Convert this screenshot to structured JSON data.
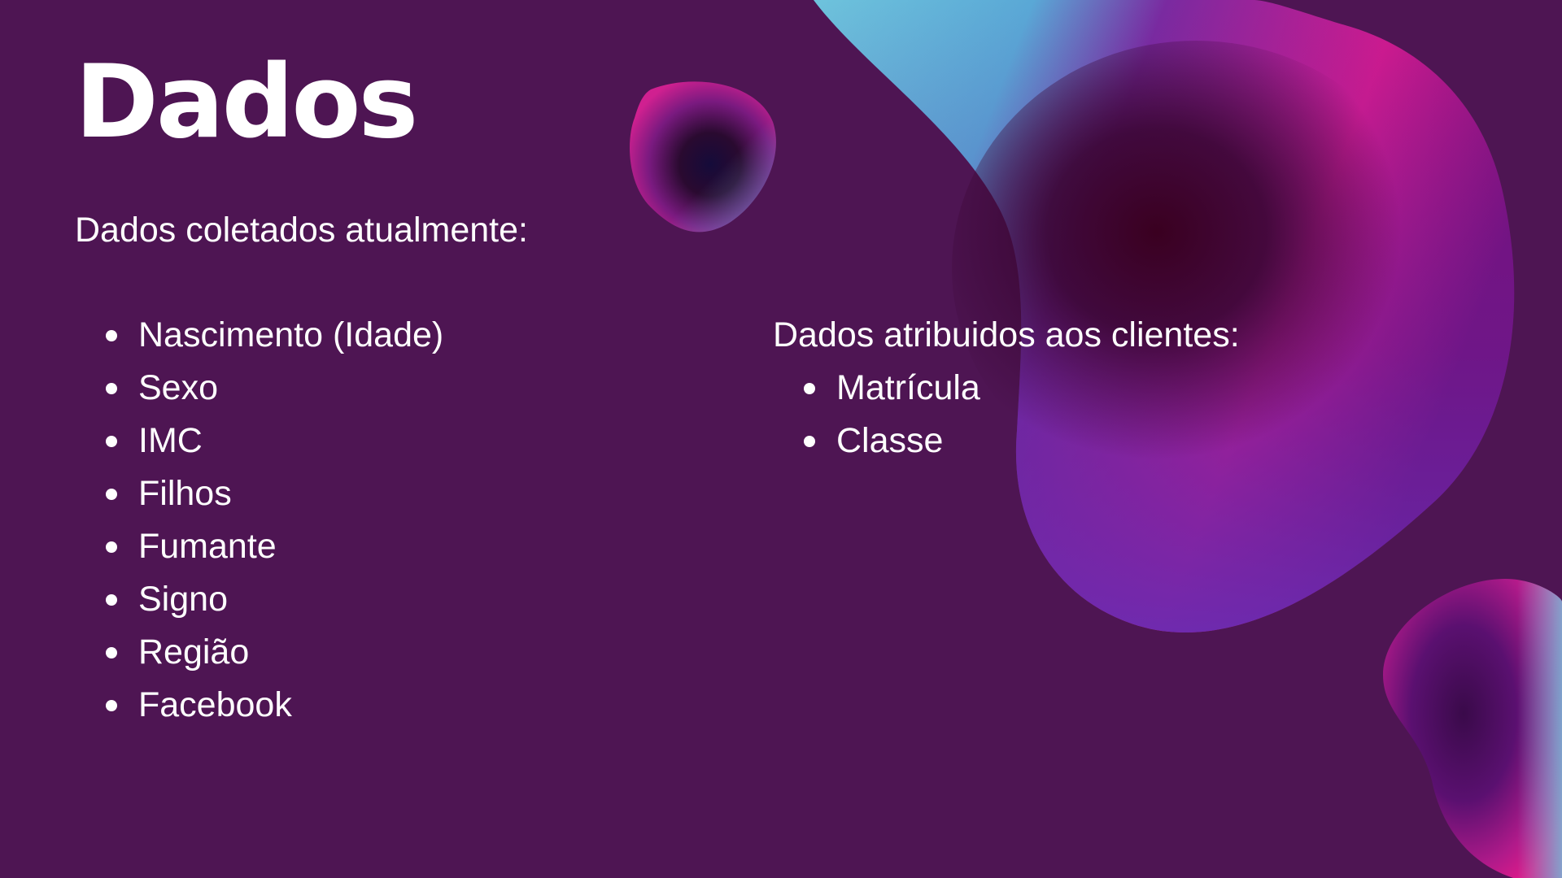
{
  "slide": {
    "title": "Dados",
    "subtitle": "Dados coletados atualmente:",
    "collected_items": [
      "Nascimento (Idade)",
      "Sexo",
      "IMC",
      "Filhos",
      "Fumante",
      "Signo",
      "Região",
      "Facebook"
    ],
    "assigned_heading": "Dados atribuidos aos clientes:",
    "assigned_items": [
      "Matrícula",
      "Classe"
    ]
  },
  "colors": {
    "background": "#4e1553",
    "text": "#ffffff",
    "blob_cyan": "#6ec3dc",
    "blob_magenta": "#e0198a",
    "blob_violet": "#5b23a0",
    "blob_dark": "#3a0020"
  },
  "icons": {
    "bullet": "bullet-dot-icon",
    "decorations": [
      "large-gradient-blob",
      "small-gradient-blob",
      "corner-gradient-blob"
    ]
  }
}
